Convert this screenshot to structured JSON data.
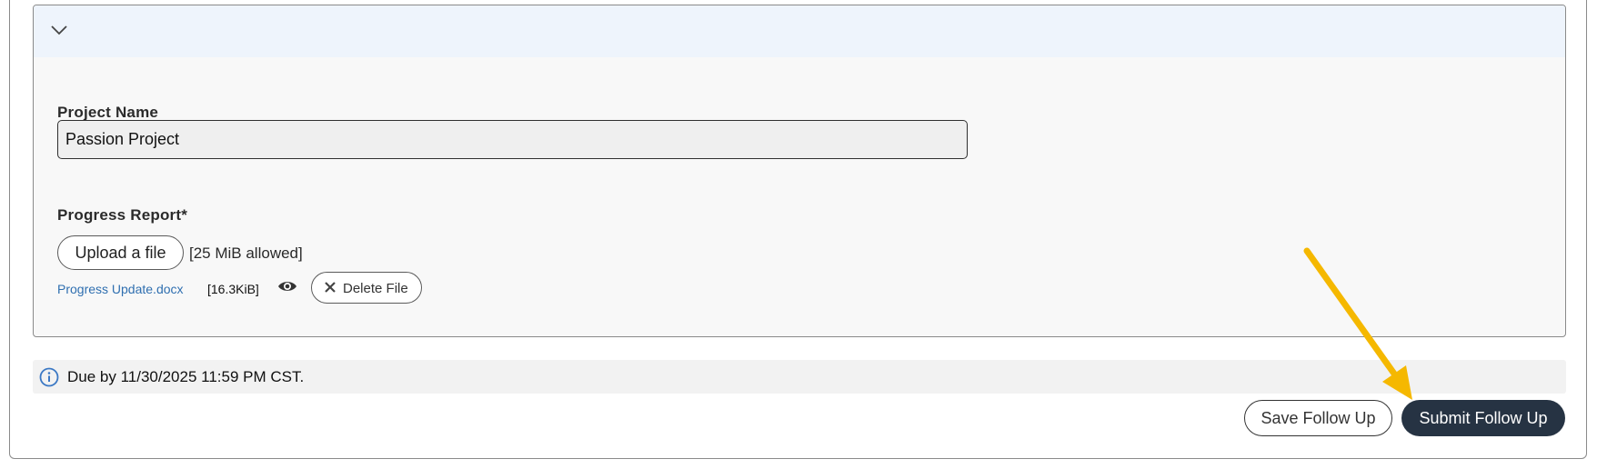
{
  "panel": {
    "project_name": {
      "label": "Project Name",
      "value": "Passion Project"
    },
    "progress_report": {
      "label": "Progress Report*",
      "upload_label": "Upload a file",
      "allowed_text": "[25 MiB allowed]",
      "file": {
        "name": "Progress Update.docx",
        "size": "[16.3KiB]",
        "delete_label": "Delete File"
      }
    }
  },
  "due_notice": {
    "text": "Due by 11/30/2025 11:59 PM CST."
  },
  "actions": {
    "save_label": "Save Follow Up",
    "submit_label": "Submit Follow Up"
  },
  "colors": {
    "header_bg": "#eef4fc",
    "link": "#2f6fb0",
    "submit_bg": "#263343",
    "annotation_arrow": "#f5b800",
    "info_icon": "#3b78c4"
  },
  "icons": {
    "collapse": "chevron-down-icon",
    "preview": "eye-icon",
    "delete": "close-icon",
    "info": "info-icon"
  }
}
